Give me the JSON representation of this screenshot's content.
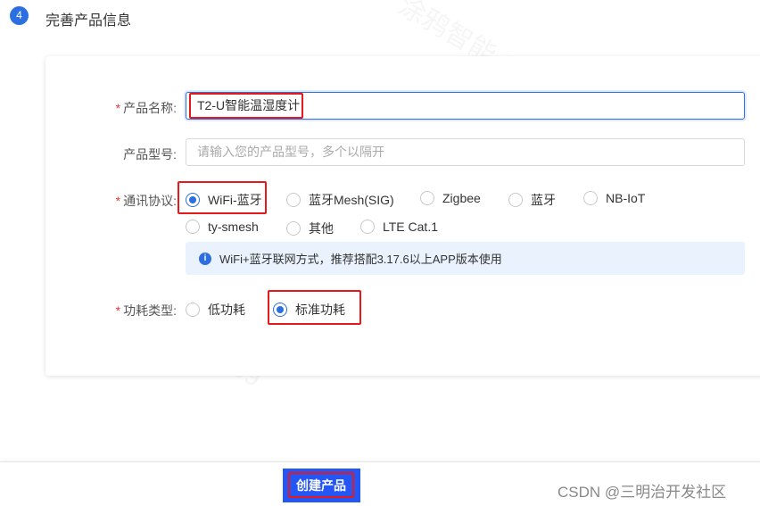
{
  "step": {
    "number": "4",
    "title": "完善产品信息"
  },
  "form": {
    "product_name": {
      "label": "产品名称:",
      "required": true,
      "value": "T2-U智能温湿度计"
    },
    "product_model": {
      "label": "产品型号:",
      "placeholder": "请输入您的产品型号，多个以隔开"
    },
    "protocol": {
      "label": "通讯协议:",
      "required": true,
      "selected": "WiFi-蓝牙",
      "options": [
        "WiFi-蓝牙",
        "蓝牙Mesh(SIG)",
        "Zigbee",
        "蓝牙",
        "NB-IoT",
        "ty-smesh",
        "其他",
        "LTE Cat.1"
      ],
      "info": "WiFi+蓝牙联网方式，推荐搭配3.17.6以上APP版本使用"
    },
    "power": {
      "label": "功耗类型:",
      "required": true,
      "selected": "标准功耗",
      "options": [
        "低功耗",
        "标准功耗"
      ]
    }
  },
  "footer": {
    "create_button": "创建产品"
  },
  "watermark": "CSDN @三明治开发社区",
  "background_watermark": "涂鸦智能-39",
  "colors": {
    "accent": "#2c6fe0",
    "button": "#2456f5",
    "highlight": "#e8191b",
    "info_bg": "#eaf3fd"
  }
}
